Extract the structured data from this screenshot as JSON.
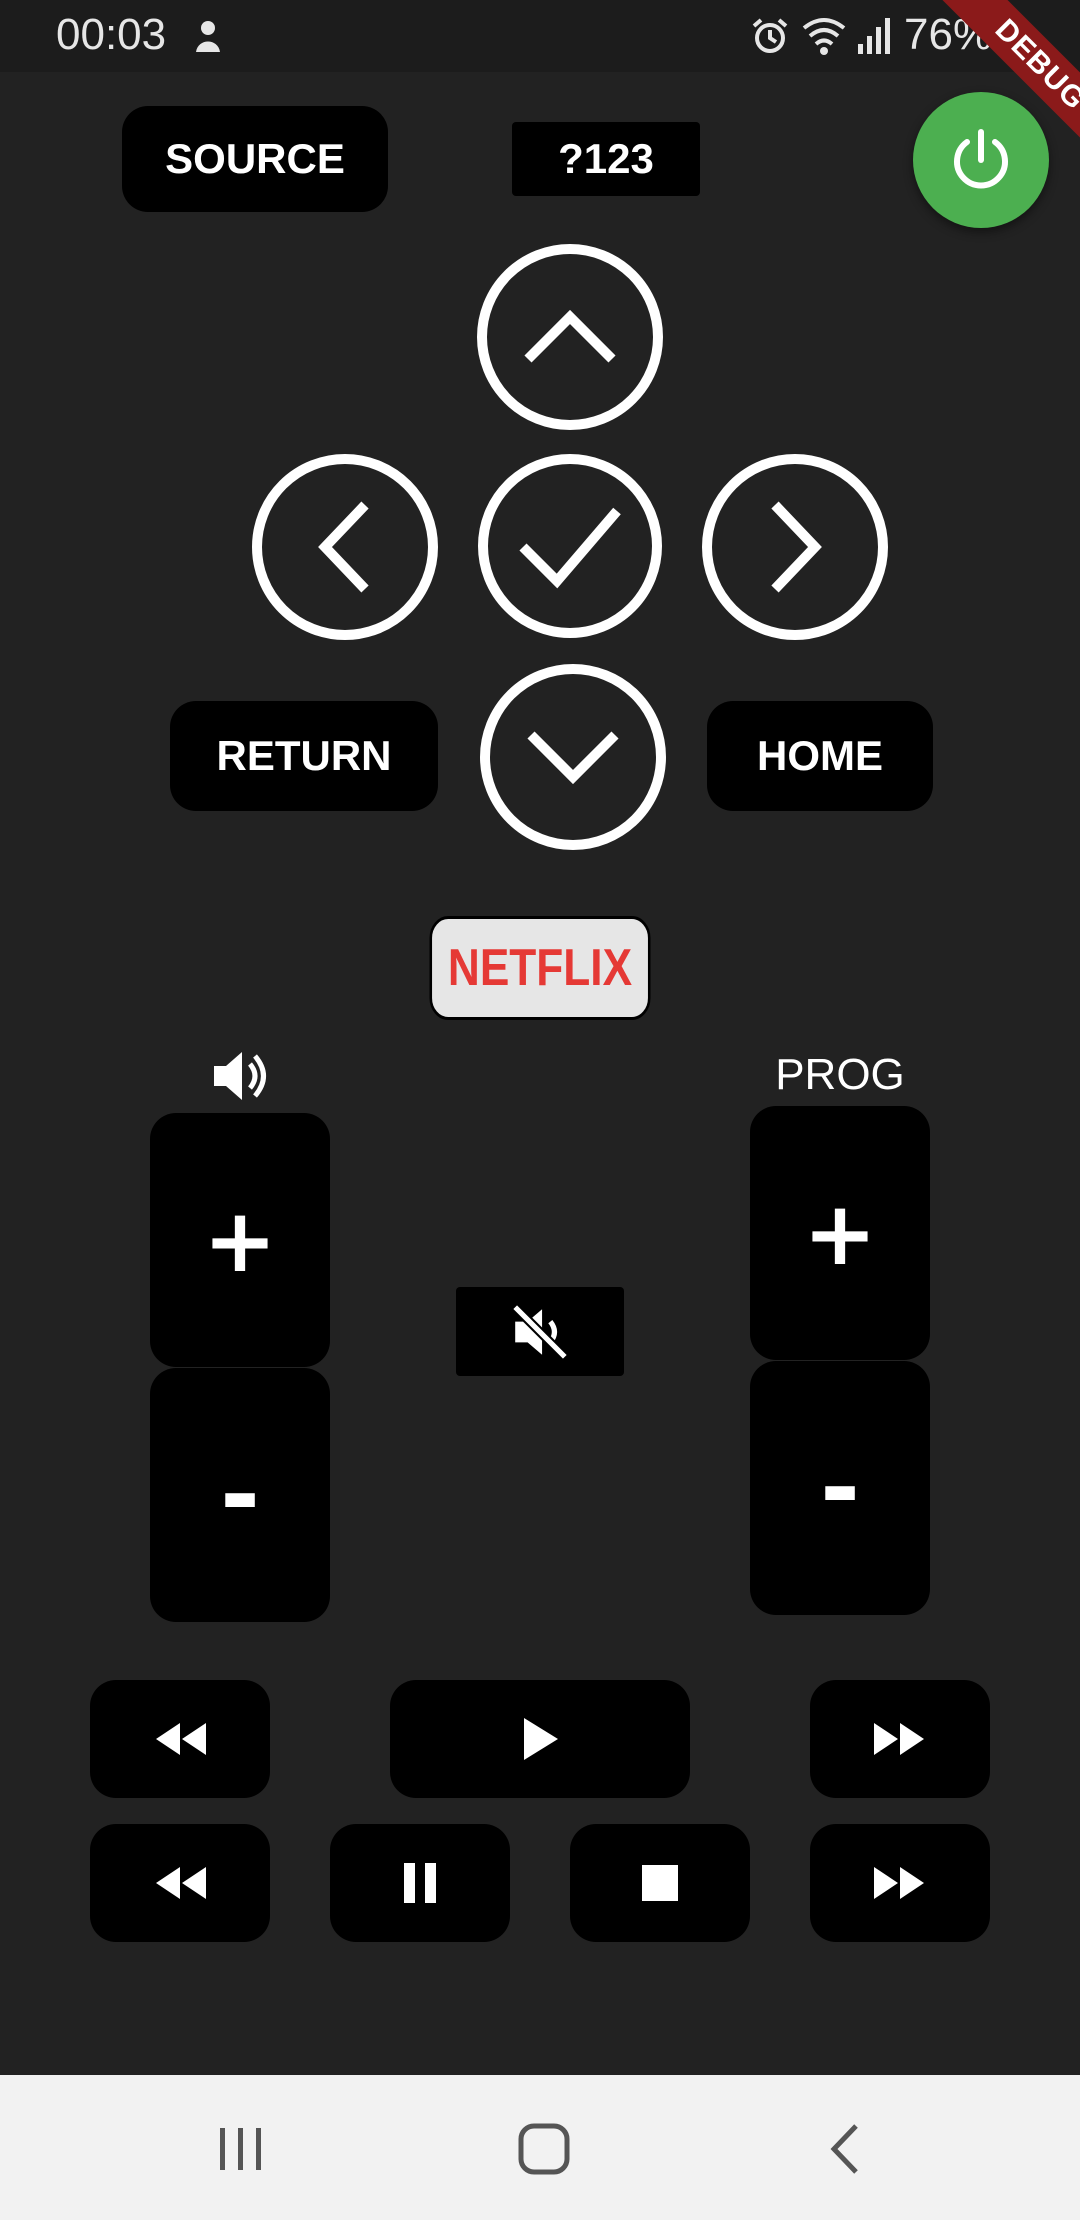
{
  "status_bar": {
    "time": "00:03",
    "battery": "76%"
  },
  "debug_banner": "DEBUG",
  "buttons": {
    "source": "SOURCE",
    "keypad": "?123",
    "return": "RETURN",
    "home": "HOME",
    "netflix": "NETFLIX",
    "prog_label": "PROG",
    "plus": "+",
    "minus": "-"
  },
  "icons": {
    "power": "power-icon",
    "up": "chevron-up-icon",
    "down": "chevron-down-icon",
    "left": "chevron-left-icon",
    "right": "chevron-right-icon",
    "ok": "check-icon",
    "volume": "volume-icon",
    "mute": "mute-icon",
    "rewind": "rewind-icon",
    "play": "play-icon",
    "fast_forward": "fast-forward-icon",
    "pause": "pause-icon",
    "stop": "stop-icon",
    "nav_recents": "recents-icon",
    "nav_home": "home-icon",
    "nav_back": "back-icon"
  },
  "colors": {
    "background": "#222222",
    "power": "#4caf50",
    "netflix": "#e53935",
    "debug": "#8b1a1a"
  }
}
